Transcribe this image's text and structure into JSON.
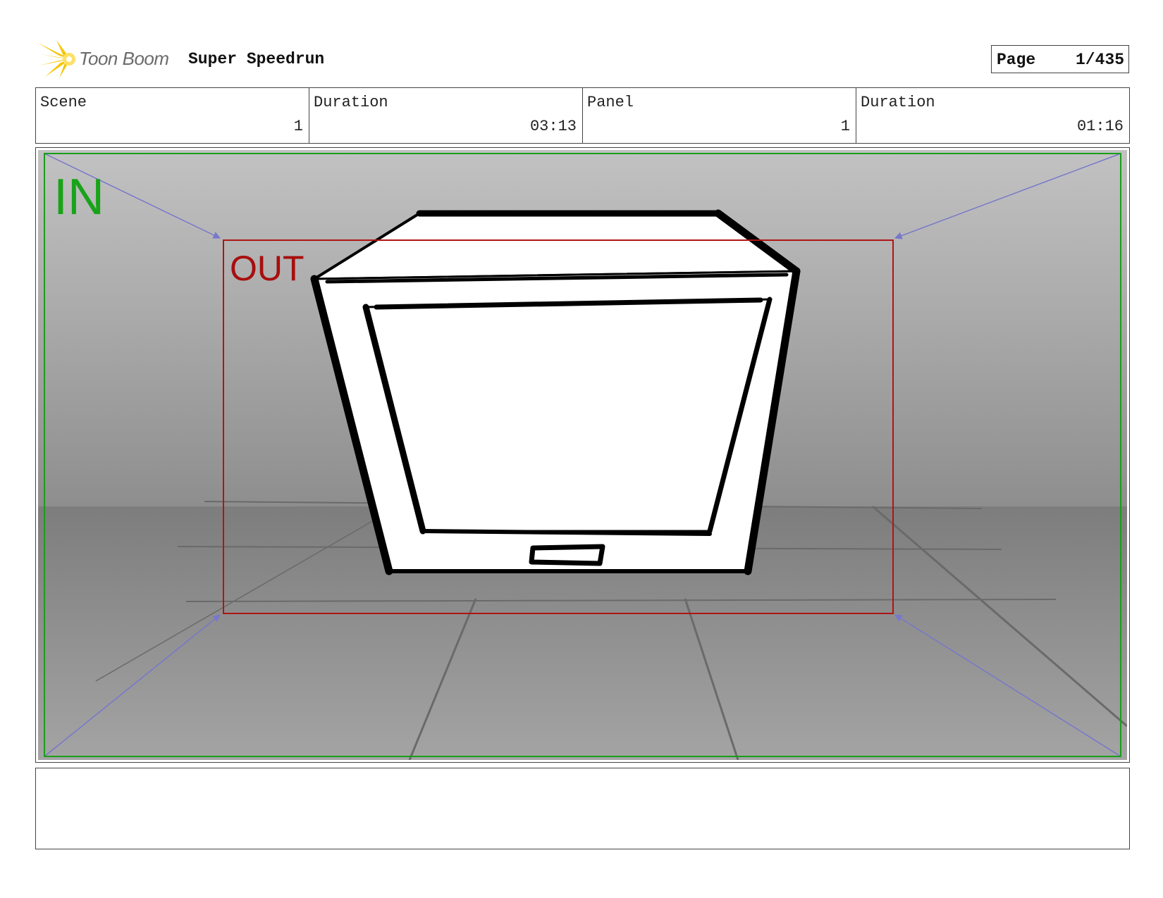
{
  "header": {
    "logo_text": "Toon Boom",
    "project_title": "Super Speedrun",
    "page_label": "Page",
    "page_value": "1/435"
  },
  "info": {
    "scene_label": "Scene",
    "scene_value": "1",
    "scene_duration_label": "Duration",
    "scene_duration_value": "03:13",
    "panel_label": "Panel",
    "panel_value": "1",
    "panel_duration_label": "Duration",
    "panel_duration_value": "01:16"
  },
  "panel": {
    "in_label": "IN",
    "out_label": "OUT",
    "colors": {
      "in_frame": "#1a9e1a",
      "out_frame": "#b01515",
      "camera_path": "#7777cc",
      "wall_top": "#bdbdbd",
      "wall_bottom": "#8f8f8f",
      "floor": "#8a8a8a"
    },
    "subject": "crate-icon"
  },
  "caption": {
    "text": ""
  }
}
